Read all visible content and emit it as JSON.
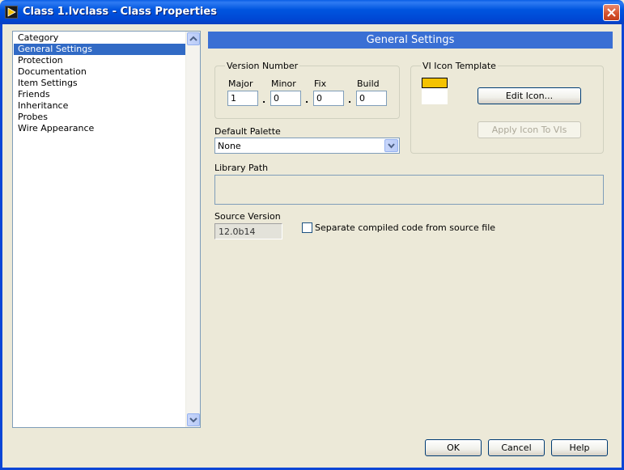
{
  "window": {
    "title": "Class 1.lvclass - Class Properties",
    "icon": "labview-run-arrow-icon",
    "close_icon": "close-x-icon"
  },
  "category": {
    "items": [
      {
        "label": "Category",
        "selected": false
      },
      {
        "label": "General Settings",
        "selected": true
      },
      {
        "label": "Protection",
        "selected": false
      },
      {
        "label": "Documentation",
        "selected": false
      },
      {
        "label": "Item Settings",
        "selected": false
      },
      {
        "label": "Friends",
        "selected": false
      },
      {
        "label": "Inheritance",
        "selected": false
      },
      {
        "label": "Probes",
        "selected": false
      },
      {
        "label": "Wire Appearance",
        "selected": false
      }
    ]
  },
  "section": {
    "title": "General Settings"
  },
  "version": {
    "group_label": "Version Number",
    "major_label": "Major",
    "minor_label": "Minor",
    "fix_label": "Fix",
    "build_label": "Build",
    "major": "1",
    "minor": "0",
    "fix": "0",
    "build": "0",
    "separator": "."
  },
  "palette": {
    "label": "Default Palette",
    "value": "None"
  },
  "icon_template": {
    "group_label": "VI Icon Template",
    "edit_button": "Edit Icon...",
    "apply_button": "Apply Icon To VIs",
    "banner_color": "#f5c200"
  },
  "library_path": {
    "label": "Library Path",
    "value": ""
  },
  "source_version": {
    "label": "Source Version",
    "value": "12.0b14",
    "separate_compiled_label": "Separate compiled code from source file",
    "separate_compiled_checked": false
  },
  "footer": {
    "ok": "OK",
    "cancel": "Cancel",
    "help": "Help"
  },
  "colors": {
    "titlebar": "#0055e0",
    "header": "#3a6fd4",
    "selection": "#316ac5",
    "face": "#ece9d8"
  }
}
